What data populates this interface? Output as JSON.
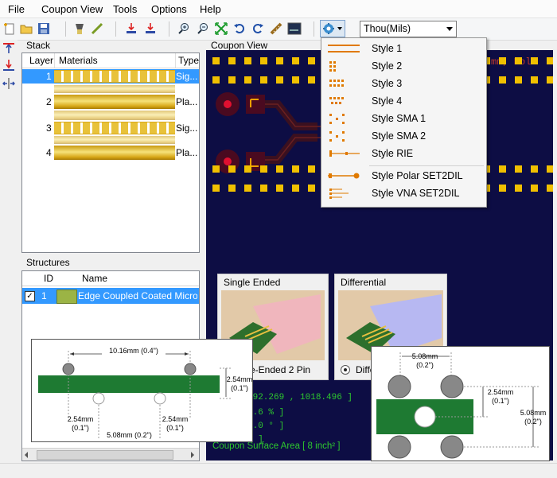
{
  "menubar": {
    "items": [
      "File",
      "Coupon View",
      "Tools",
      "Options",
      "Help"
    ]
  },
  "toolbar": {
    "units_value": "Thou(Mils)"
  },
  "stack_panel": {
    "title": "Stack",
    "columns": [
      "Layer",
      "Materials",
      "Type"
    ],
    "rows": [
      {
        "layer": "1",
        "type": "Sig...",
        "kind": "signal"
      },
      {
        "layer": "2",
        "type": "Pla...",
        "kind": "plane"
      },
      {
        "layer": "3",
        "type": "Sig...",
        "kind": "signal"
      },
      {
        "layer": "4",
        "type": "Pla...",
        "kind": "plane"
      }
    ]
  },
  "structures_panel": {
    "title": "Structures",
    "columns": [
      "ID",
      "Name"
    ],
    "rows": [
      {
        "id": "1",
        "name": "Edge Coupled Coated Microstrip",
        "checked": true
      }
    ]
  },
  "coupon_view": {
    "title": "Coupon View",
    "header_text": "mm, Pola",
    "status_lines": [
      "392.269 , 1018.496 ]",
      "5.6 % ]",
      "0.0 ° ]",
      "u ]",
      "Coupon Surface Area [ 8 inch² ]"
    ]
  },
  "style_menu": {
    "items": [
      {
        "label": "Style 1",
        "icon": "style-1-icon"
      },
      {
        "label": "Style 2",
        "icon": "style-2-icon"
      },
      {
        "label": "Style 3",
        "icon": "style-3-icon"
      },
      {
        "label": "Style 4",
        "icon": "style-4-icon"
      },
      {
        "label": "Style SMA 1",
        "icon": "style-sma1-icon"
      },
      {
        "label": "Style SMA 2",
        "icon": "style-sma2-icon"
      },
      {
        "label": "Style RIE",
        "icon": "style-rie-icon"
      },
      {
        "label": "Style Polar SET2DIL",
        "icon": "style-polar-icon"
      },
      {
        "label": "Style VNA SET2DIL",
        "icon": "style-vna-icon"
      }
    ]
  },
  "probe_options": {
    "single_ended": {
      "title": "Single Ended",
      "caption": "e-Ended 2 Pin"
    },
    "differential": {
      "title": "Differential",
      "caption": "Diffe"
    }
  },
  "diagram_left": {
    "top_dim": "10.16mm (0.4\")",
    "right_dim_a": "2.54mm",
    "right_dim_b": "(0.1\")",
    "bl_dim_a": "2.54mm",
    "bl_dim_b": "(0.1\")",
    "br_dim_a": "2.54mm",
    "br_dim_b": "(0.1\")",
    "bottom_dim": "5.08mm (0.2\")"
  },
  "diagram_right": {
    "top_dim_a": "5.08mm",
    "top_dim_b": "(0.2\")",
    "mid_dim_a": "2.54mm",
    "mid_dim_b": "(0.1\")",
    "right_dim_a": "5.08mm",
    "right_dim_b": "(0.2\")"
  },
  "colors": {
    "coupon_bg": "#0d0d44",
    "pad": "#f0c000",
    "board_green": "#1e7a32",
    "status_green": "#2ec82e",
    "selection_blue": "#3399ff"
  }
}
